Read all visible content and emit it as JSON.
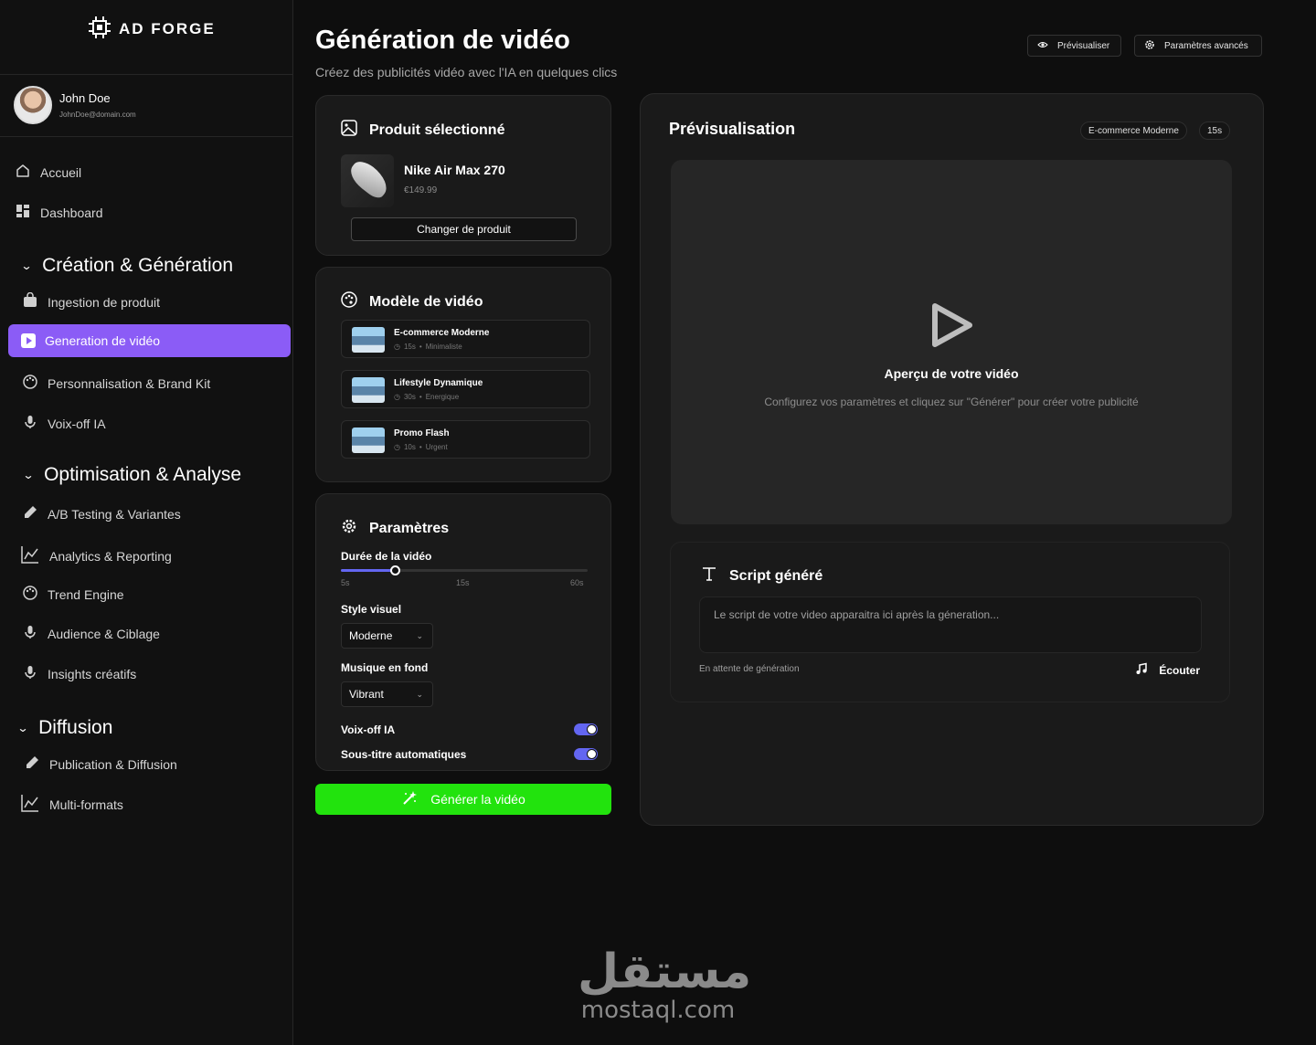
{
  "brand": {
    "name": "AD FORGE",
    "icon": "chip-logo-icon"
  },
  "user": {
    "name": "John Doe",
    "email": "JohnDoe@domain.com"
  },
  "sidebar": {
    "top_items": [
      {
        "label": "Accueil",
        "icon": "home-icon"
      },
      {
        "label": "Dashboard",
        "icon": "dashboard-grid-icon"
      }
    ],
    "sections": [
      {
        "title": "Création & Génération",
        "items": [
          {
            "label": "Ingestion de produit",
            "icon": "bag-icon"
          },
          {
            "label": "Generation de vidéo",
            "icon": "play-icon",
            "active": true
          },
          {
            "label": "Personnalisation & Brand Kit",
            "icon": "palette-icon"
          },
          {
            "label": "Voix-off IA",
            "icon": "microphone-icon"
          }
        ]
      },
      {
        "title": "Optimisation & Analyse",
        "items": [
          {
            "label": "A/B Testing & Variantes",
            "icon": "pen-icon"
          },
          {
            "label": "Analytics & Reporting",
            "icon": "chart-line-icon"
          },
          {
            "label": "Trend Engine",
            "icon": "palette-icon"
          },
          {
            "label": "Audience & Ciblage",
            "icon": "microphone-icon"
          },
          {
            "label": "Insights créatifs",
            "icon": "microphone-icon"
          }
        ]
      },
      {
        "title": "Diffusion",
        "items": [
          {
            "label": "Publication & Diffusion",
            "icon": "pen-icon"
          },
          {
            "label": "Multi-formats",
            "icon": "chart-line-icon"
          }
        ]
      }
    ]
  },
  "header": {
    "title": "Génération de vidéo",
    "subtitle": "Créez des publicités vidéo avec l'IA en quelques clics",
    "preview_button": "Prévisualiser",
    "advanced_button": "Paramètres avancés"
  },
  "product": {
    "card_title": "Produit sélectionné",
    "name": "Nike Air Max 270",
    "price": "€149.99",
    "change_button": "Changer de produit"
  },
  "templates": {
    "card_title": "Modèle de vidéo",
    "items": [
      {
        "name": "E-commerce Moderne",
        "duration": "15s",
        "style": "Minimaliste"
      },
      {
        "name": "Lifestyle Dynamique",
        "duration": "30s",
        "style": "Energique"
      },
      {
        "name": "Promo Flash",
        "duration": "10s",
        "style": "Urgent"
      }
    ]
  },
  "params": {
    "card_title": "Paramètres",
    "duration_label": "Durée de la vidéo",
    "duration_ticks": [
      "5s",
      "15s",
      "60s"
    ],
    "duration_fraction": 0.22,
    "style_label": "Style visuel",
    "style_value": "Moderne",
    "music_label": "Musique en fond",
    "music_value": "Vibrant",
    "voiceover_label": "Voix-off IA",
    "voiceover_on": true,
    "subtitles_label": "Sous-titre automatiques",
    "subtitles_on": true,
    "accent_color": "#6366f1"
  },
  "generate_button": "Générer la vidéo",
  "preview": {
    "title": "Prévisualisation",
    "chip_template": "E-commerce Moderne",
    "chip_duration": "15s",
    "stage_title": "Aperçu de votre vidéo",
    "stage_subtitle": "Configurez vos paramètres et cliquez sur \"Générer\" pour créer votre publicité"
  },
  "script": {
    "title": "Script généré",
    "placeholder": "Le script de votre video apparaitra ici après la géneration...",
    "status": "En attente de génération",
    "listen_button": "Écouter"
  },
  "watermark": {
    "arabic": "مستقل",
    "latin": "mostaql.com"
  },
  "colors": {
    "active_nav": "#8b5cf6",
    "generate": "#22e30d",
    "background": "#0e0e0e"
  }
}
